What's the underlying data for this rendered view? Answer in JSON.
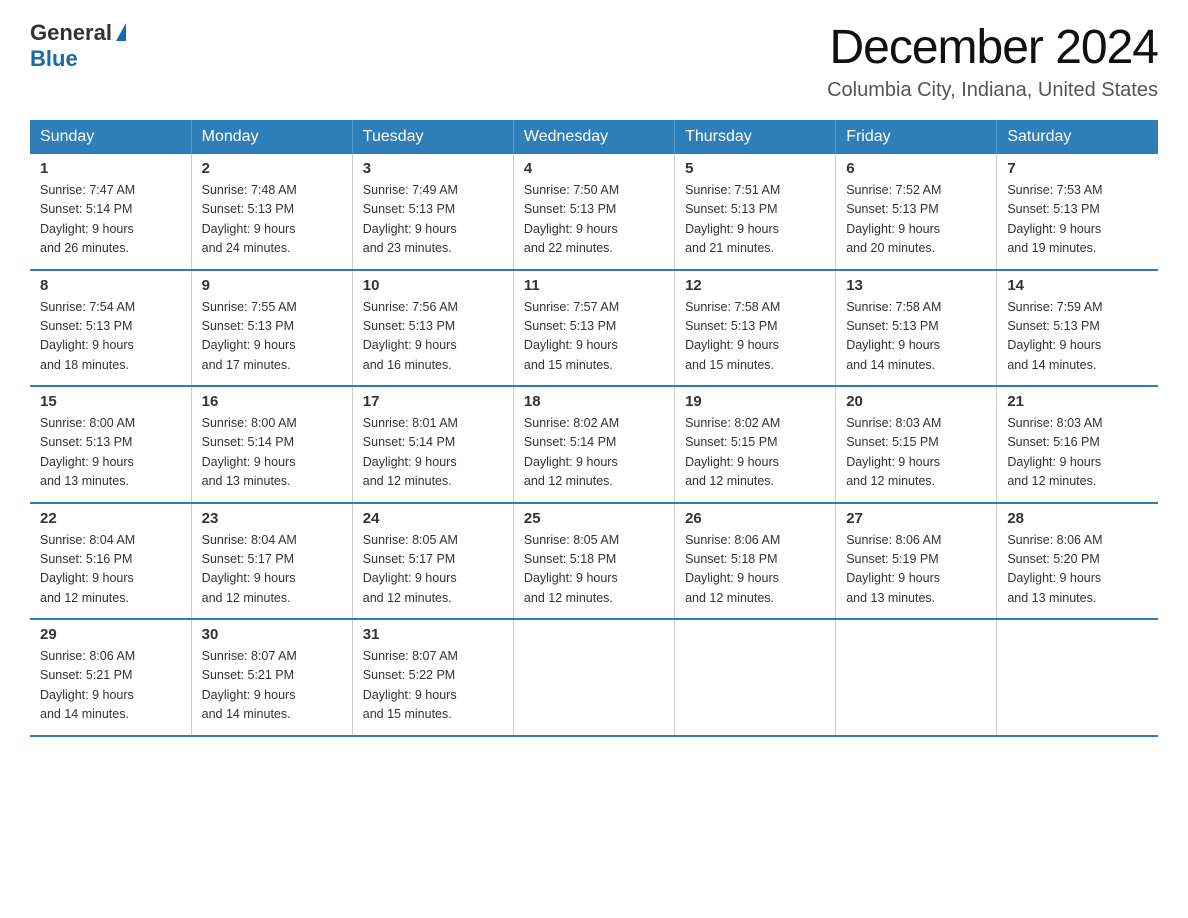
{
  "header": {
    "logo_general": "General",
    "logo_blue": "Blue",
    "month_title": "December 2024",
    "location": "Columbia City, Indiana, United States"
  },
  "days_of_week": [
    "Sunday",
    "Monday",
    "Tuesday",
    "Wednesday",
    "Thursday",
    "Friday",
    "Saturday"
  ],
  "weeks": [
    [
      {
        "day": "1",
        "sunrise": "7:47 AM",
        "sunset": "5:14 PM",
        "daylight": "9 hours and 26 minutes."
      },
      {
        "day": "2",
        "sunrise": "7:48 AM",
        "sunset": "5:13 PM",
        "daylight": "9 hours and 24 minutes."
      },
      {
        "day": "3",
        "sunrise": "7:49 AM",
        "sunset": "5:13 PM",
        "daylight": "9 hours and 23 minutes."
      },
      {
        "day": "4",
        "sunrise": "7:50 AM",
        "sunset": "5:13 PM",
        "daylight": "9 hours and 22 minutes."
      },
      {
        "day": "5",
        "sunrise": "7:51 AM",
        "sunset": "5:13 PM",
        "daylight": "9 hours and 21 minutes."
      },
      {
        "day": "6",
        "sunrise": "7:52 AM",
        "sunset": "5:13 PM",
        "daylight": "9 hours and 20 minutes."
      },
      {
        "day": "7",
        "sunrise": "7:53 AM",
        "sunset": "5:13 PM",
        "daylight": "9 hours and 19 minutes."
      }
    ],
    [
      {
        "day": "8",
        "sunrise": "7:54 AM",
        "sunset": "5:13 PM",
        "daylight": "9 hours and 18 minutes."
      },
      {
        "day": "9",
        "sunrise": "7:55 AM",
        "sunset": "5:13 PM",
        "daylight": "9 hours and 17 minutes."
      },
      {
        "day": "10",
        "sunrise": "7:56 AM",
        "sunset": "5:13 PM",
        "daylight": "9 hours and 16 minutes."
      },
      {
        "day": "11",
        "sunrise": "7:57 AM",
        "sunset": "5:13 PM",
        "daylight": "9 hours and 15 minutes."
      },
      {
        "day": "12",
        "sunrise": "7:58 AM",
        "sunset": "5:13 PM",
        "daylight": "9 hours and 15 minutes."
      },
      {
        "day": "13",
        "sunrise": "7:58 AM",
        "sunset": "5:13 PM",
        "daylight": "9 hours and 14 minutes."
      },
      {
        "day": "14",
        "sunrise": "7:59 AM",
        "sunset": "5:13 PM",
        "daylight": "9 hours and 14 minutes."
      }
    ],
    [
      {
        "day": "15",
        "sunrise": "8:00 AM",
        "sunset": "5:13 PM",
        "daylight": "9 hours and 13 minutes."
      },
      {
        "day": "16",
        "sunrise": "8:00 AM",
        "sunset": "5:14 PM",
        "daylight": "9 hours and 13 minutes."
      },
      {
        "day": "17",
        "sunrise": "8:01 AM",
        "sunset": "5:14 PM",
        "daylight": "9 hours and 12 minutes."
      },
      {
        "day": "18",
        "sunrise": "8:02 AM",
        "sunset": "5:14 PM",
        "daylight": "9 hours and 12 minutes."
      },
      {
        "day": "19",
        "sunrise": "8:02 AM",
        "sunset": "5:15 PM",
        "daylight": "9 hours and 12 minutes."
      },
      {
        "day": "20",
        "sunrise": "8:03 AM",
        "sunset": "5:15 PM",
        "daylight": "9 hours and 12 minutes."
      },
      {
        "day": "21",
        "sunrise": "8:03 AM",
        "sunset": "5:16 PM",
        "daylight": "9 hours and 12 minutes."
      }
    ],
    [
      {
        "day": "22",
        "sunrise": "8:04 AM",
        "sunset": "5:16 PM",
        "daylight": "9 hours and 12 minutes."
      },
      {
        "day": "23",
        "sunrise": "8:04 AM",
        "sunset": "5:17 PM",
        "daylight": "9 hours and 12 minutes."
      },
      {
        "day": "24",
        "sunrise": "8:05 AM",
        "sunset": "5:17 PM",
        "daylight": "9 hours and 12 minutes."
      },
      {
        "day": "25",
        "sunrise": "8:05 AM",
        "sunset": "5:18 PM",
        "daylight": "9 hours and 12 minutes."
      },
      {
        "day": "26",
        "sunrise": "8:06 AM",
        "sunset": "5:18 PM",
        "daylight": "9 hours and 12 minutes."
      },
      {
        "day": "27",
        "sunrise": "8:06 AM",
        "sunset": "5:19 PM",
        "daylight": "9 hours and 13 minutes."
      },
      {
        "day": "28",
        "sunrise": "8:06 AM",
        "sunset": "5:20 PM",
        "daylight": "9 hours and 13 minutes."
      }
    ],
    [
      {
        "day": "29",
        "sunrise": "8:06 AM",
        "sunset": "5:21 PM",
        "daylight": "9 hours and 14 minutes."
      },
      {
        "day": "30",
        "sunrise": "8:07 AM",
        "sunset": "5:21 PM",
        "daylight": "9 hours and 14 minutes."
      },
      {
        "day": "31",
        "sunrise": "8:07 AM",
        "sunset": "5:22 PM",
        "daylight": "9 hours and 15 minutes."
      },
      null,
      null,
      null,
      null
    ]
  ],
  "labels": {
    "sunrise": "Sunrise: ",
    "sunset": "Sunset: ",
    "daylight": "Daylight: "
  },
  "colors": {
    "header_bg": "#2e7eba",
    "accent": "#1a6aa8"
  }
}
